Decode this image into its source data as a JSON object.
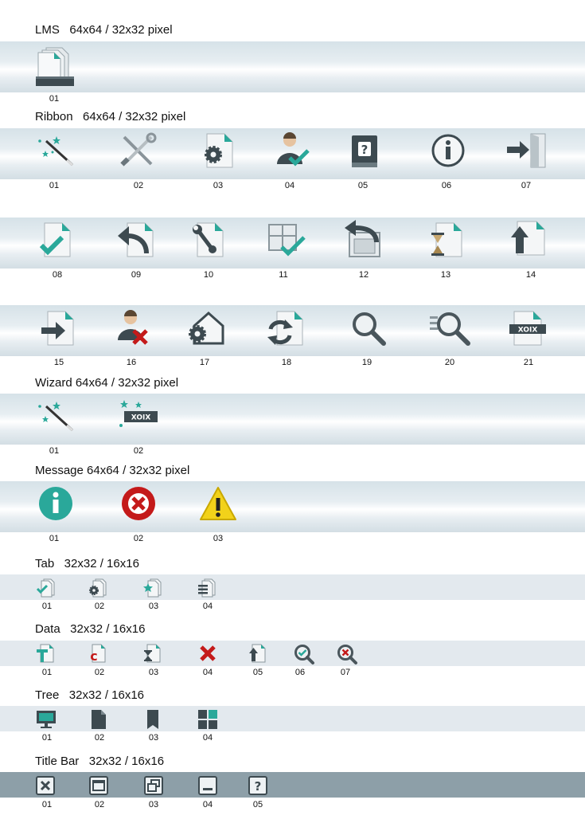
{
  "sections": [
    {
      "title": "LMS   64x64 / 32x32 pixel",
      "items": [
        {
          "label": "01",
          "icon": "lms-stack-icon"
        }
      ]
    },
    {
      "title": "Ribbon   64x64 / 32x32 pixel",
      "items": [
        {
          "label": "01",
          "icon": "magic-wand-icon"
        },
        {
          "label": "02",
          "icon": "tools-icon"
        },
        {
          "label": "03",
          "icon": "document-gear-icon"
        },
        {
          "label": "04",
          "icon": "user-check-icon"
        },
        {
          "label": "05",
          "icon": "help-book-icon"
        },
        {
          "label": "06",
          "icon": "info-icon"
        },
        {
          "label": "07",
          "icon": "login-door-icon"
        },
        {
          "label": "08",
          "icon": "document-check-icon"
        },
        {
          "label": "09",
          "icon": "document-undo-icon"
        },
        {
          "label": "10",
          "icon": "document-wrench-icon"
        },
        {
          "label": "11",
          "icon": "window-check-icon"
        },
        {
          "label": "12",
          "icon": "window-return-icon"
        },
        {
          "label": "13",
          "icon": "document-hourglass-icon"
        },
        {
          "label": "14",
          "icon": "document-upload-icon"
        },
        {
          "label": "15",
          "icon": "document-import-icon"
        },
        {
          "label": "16",
          "icon": "user-remove-icon"
        },
        {
          "label": "17",
          "icon": "home-gear-icon"
        },
        {
          "label": "18",
          "icon": "document-refresh-icon"
        },
        {
          "label": "19",
          "icon": "search-icon"
        },
        {
          "label": "20",
          "icon": "search-list-icon"
        },
        {
          "label": "21",
          "icon": "document-xoix-icon"
        }
      ]
    },
    {
      "title": "Wizard 64x64 / 32x32 pixel",
      "items": [
        {
          "label": "01",
          "icon": "magic-wand-icon"
        },
        {
          "label": "02",
          "icon": "xoix-wizard-icon"
        }
      ]
    },
    {
      "title": "Message 64x64 / 32x32 pixel",
      "items": [
        {
          "label": "01",
          "icon": "message-info-icon"
        },
        {
          "label": "02",
          "icon": "message-error-icon"
        },
        {
          "label": "03",
          "icon": "message-warning-icon"
        }
      ]
    },
    {
      "title": "Tab   32x32 / 16x16",
      "items": [
        {
          "label": "01",
          "icon": "tab-check-icon"
        },
        {
          "label": "02",
          "icon": "tab-gear-icon"
        },
        {
          "label": "03",
          "icon": "tab-star-icon"
        },
        {
          "label": "04",
          "icon": "tab-list-icon"
        }
      ]
    },
    {
      "title": "Data   32x32 / 16x16",
      "items": [
        {
          "label": "01",
          "icon": "data-t-icon"
        },
        {
          "label": "02",
          "icon": "data-c-icon"
        },
        {
          "label": "03",
          "icon": "data-hourglass-icon"
        },
        {
          "label": "04",
          "icon": "data-delete-icon"
        },
        {
          "label": "05",
          "icon": "data-upload-icon"
        },
        {
          "label": "06",
          "icon": "data-search-check-icon"
        },
        {
          "label": "07",
          "icon": "data-search-delete-icon"
        }
      ]
    },
    {
      "title": "Tree   32x32 / 16x16",
      "items": [
        {
          "label": "01",
          "icon": "tree-monitor-icon"
        },
        {
          "label": "02",
          "icon": "tree-document-icon"
        },
        {
          "label": "03",
          "icon": "tree-bookmark-icon"
        },
        {
          "label": "04",
          "icon": "tree-grid-icon"
        }
      ]
    },
    {
      "title": "Title Bar   32x32 / 16x16",
      "items": [
        {
          "label": "01",
          "icon": "close-icon"
        },
        {
          "label": "02",
          "icon": "maximize-icon"
        },
        {
          "label": "03",
          "icon": "restore-icon"
        },
        {
          "label": "04",
          "icon": "minimize-icon"
        },
        {
          "label": "05",
          "icon": "help-icon"
        }
      ]
    }
  ],
  "colors": {
    "accent": "#2aa89a",
    "dark": "#3d4a50",
    "error": "#c41a1a",
    "warning": "#f2d21a",
    "band_dark": "#8d9fa8"
  }
}
